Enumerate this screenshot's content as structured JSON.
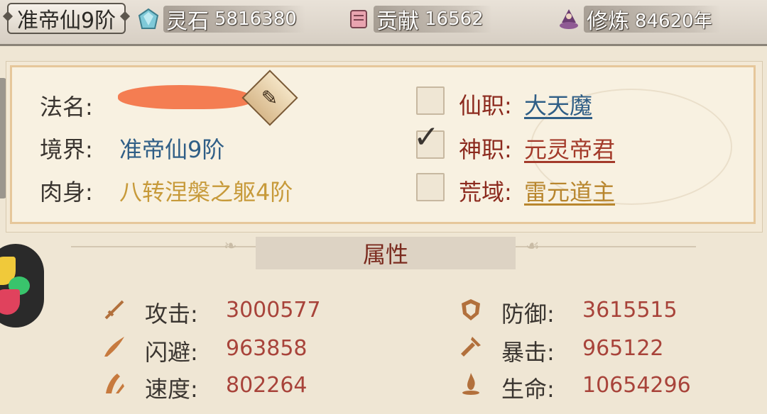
{
  "topbar": {
    "realm": "准帝仙9阶",
    "resources": [
      {
        "name": "灵石",
        "value": "5816380",
        "icon": "spirit-stone-icon"
      },
      {
        "name": "贡献",
        "value": "16562",
        "icon": "contribution-scroll-icon"
      },
      {
        "name": "修炼",
        "value": "84620年",
        "icon": "cultivation-figure-icon"
      }
    ]
  },
  "profile": {
    "name_label": "法名:",
    "name_value": "(已涂抹)",
    "realm_label": "境界:",
    "realm_value": "准帝仙9阶",
    "body_label": "肉身:",
    "body_value": "八转涅槃之躯4阶"
  },
  "titles": [
    {
      "label": "仙职:",
      "value": "大天魔",
      "checked": false,
      "color": "#2f5e86"
    },
    {
      "label": "神职:",
      "value": "元灵帝君",
      "checked": true,
      "color": "#a33a2a"
    },
    {
      "label": "荒域:",
      "value": "雷元道主",
      "checked": false,
      "color": "#b8862e"
    }
  ],
  "attributes": {
    "header": "属性",
    "stats": [
      {
        "label": "攻击:",
        "value": "3000577",
        "icon": "attack-sword-icon"
      },
      {
        "label": "防御:",
        "value": "3615515",
        "icon": "defense-shield-icon"
      },
      {
        "label": "闪避:",
        "value": "963858",
        "icon": "dodge-wing-icon"
      },
      {
        "label": "暴击:",
        "value": "965122",
        "icon": "critical-strike-icon"
      },
      {
        "label": "速度:",
        "value": "802264",
        "icon": "speed-icon"
      },
      {
        "label": "生命:",
        "value": "10654296",
        "icon": "life-flame-icon"
      }
    ]
  },
  "colors": {
    "realm_value": "#2f5e86",
    "body_value": "#c79a3a",
    "stat_value": "#a8433a",
    "label": "#3a3530"
  }
}
